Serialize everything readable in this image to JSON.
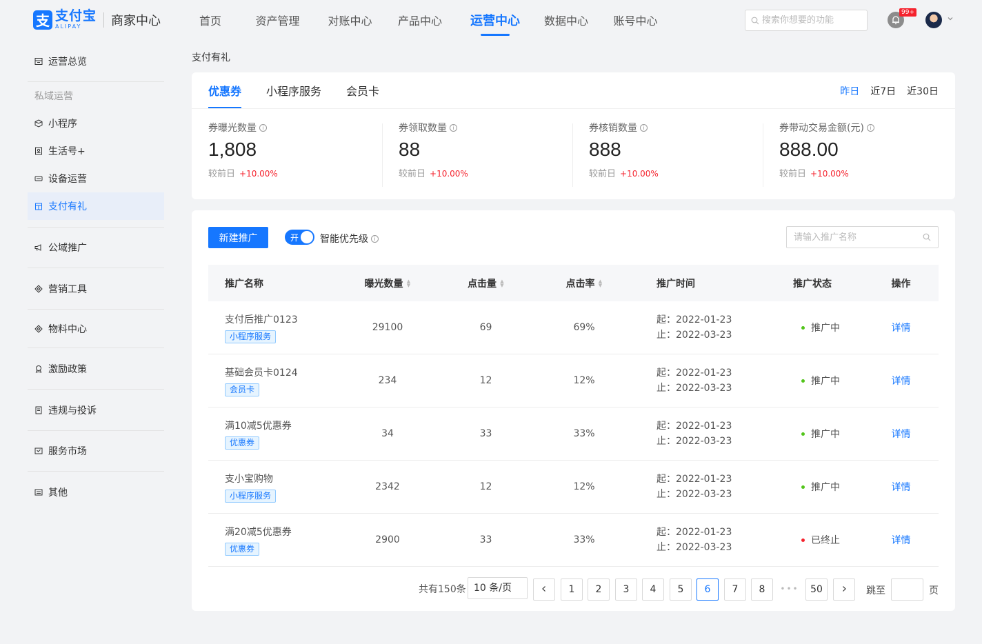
{
  "brand": {
    "cn": "支付宝",
    "en": "ALIPAY",
    "sub": "商家中心",
    "mark": "支"
  },
  "nav": {
    "items": [
      {
        "label": "首页",
        "active": false
      },
      {
        "label": "资产管理",
        "active": false
      },
      {
        "label": "对账中心",
        "active": false
      },
      {
        "label": "产品中心",
        "active": false
      },
      {
        "label": "运营中心",
        "active": true
      },
      {
        "label": "数据中心",
        "active": false
      },
      {
        "label": "账号中心",
        "active": false
      }
    ],
    "search_placeholder": "搜索你想要的功能",
    "notification_badge": "99+"
  },
  "sidebar": {
    "overview": "运营总览",
    "group_private": "私域运营",
    "private_items": [
      {
        "label": "小程序",
        "icon": "cube-icon",
        "active": false
      },
      {
        "label": "生活号+",
        "icon": "user-card-icon",
        "active": false
      },
      {
        "label": "设备运营",
        "icon": "device-icon",
        "active": false
      },
      {
        "label": "支付有礼",
        "icon": "gift-icon",
        "active": true
      }
    ],
    "sections": [
      {
        "label": "公域推广",
        "icon": "megaphone-icon"
      },
      {
        "label": "营销工具",
        "icon": "diamond-icon"
      },
      {
        "label": "物料中心",
        "icon": "diamond-icon"
      },
      {
        "label": "激励政策",
        "icon": "award-icon"
      },
      {
        "label": "违规与投诉",
        "icon": "document-icon"
      },
      {
        "label": "服务市场",
        "icon": "store-icon"
      },
      {
        "label": "其他",
        "icon": "more-icon"
      }
    ]
  },
  "page": {
    "title": "支付有礼"
  },
  "overview_card": {
    "tabs": [
      {
        "label": "优惠券",
        "active": true
      },
      {
        "label": "小程序服务",
        "active": false
      },
      {
        "label": "会员卡",
        "active": false
      }
    ],
    "ranges": [
      {
        "label": "昨日",
        "active": true
      },
      {
        "label": "近7日",
        "active": false
      },
      {
        "label": "近30日",
        "active": false
      }
    ],
    "stats": [
      {
        "label": "券曝光数量",
        "value": "1,808",
        "compare_label": "较前日",
        "change": "+10.00%"
      },
      {
        "label": "券领取数量",
        "value": "88",
        "compare_label": "较前日",
        "change": "+10.00%"
      },
      {
        "label": "券核销数量",
        "value": "888",
        "compare_label": "较前日",
        "change": "+10.00%"
      },
      {
        "label": "券带动交易金额(元)",
        "value": "888.00",
        "compare_label": "较前日",
        "change": "+10.00%"
      }
    ]
  },
  "list": {
    "new_button": "新建推广",
    "toggle": {
      "text": "开",
      "label": "智能优先级",
      "on": true
    },
    "search_placeholder": "请输入推广名称",
    "columns": [
      "推广名称",
      "曝光数量",
      "点击量",
      "点击率",
      "推广时间",
      "推广状态",
      "操作"
    ],
    "rows": [
      {
        "name": "支付后推广0123",
        "tag": "小程序服务",
        "exposure": "29100",
        "clicks": "69",
        "rate": "69%",
        "start": "起：2022-01-23",
        "end": "止：2022-03-23",
        "status": "推广中",
        "status_color": "#52c41a",
        "op": "详情"
      },
      {
        "name": "基础会员卡0124",
        "tag": "会员卡",
        "exposure": "234",
        "clicks": "12",
        "rate": "12%",
        "start": "起：2022-01-23",
        "end": "止：2022-03-23",
        "status": "推广中",
        "status_color": "#52c41a",
        "op": "详情"
      },
      {
        "name": "满10减5优惠券",
        "tag": "优惠券",
        "exposure": "34",
        "clicks": "33",
        "rate": "33%",
        "start": "起：2022-01-23",
        "end": "止：2022-03-23",
        "status": "推广中",
        "status_color": "#52c41a",
        "op": "详情"
      },
      {
        "name": "支小宝购物",
        "tag": "小程序服务",
        "exposure": "2342",
        "clicks": "12",
        "rate": "12%",
        "start": "起：2022-01-23",
        "end": "止：2022-03-23",
        "status": "推广中",
        "status_color": "#52c41a",
        "op": "详情"
      },
      {
        "name": "满20减5优惠券",
        "tag": "优惠券",
        "exposure": "2900",
        "clicks": "33",
        "rate": "33%",
        "start": "起：2022-01-23",
        "end": "止：2022-03-23",
        "status": "已终止",
        "status_color": "#f5222d",
        "op": "详情"
      }
    ],
    "pagination": {
      "total": "共有150条",
      "page_size": "10 条/页",
      "pages": [
        "1",
        "2",
        "3",
        "4",
        "5",
        "6",
        "7",
        "8"
      ],
      "current": "6",
      "ellipsis": "•••",
      "last": "50",
      "jump_label": "跳至",
      "page_suffix": "页"
    }
  },
  "colors": {
    "accent": "#1677ff",
    "up": "#f5222d",
    "active_status": "#52c41a",
    "ended_status": "#f5222d"
  }
}
